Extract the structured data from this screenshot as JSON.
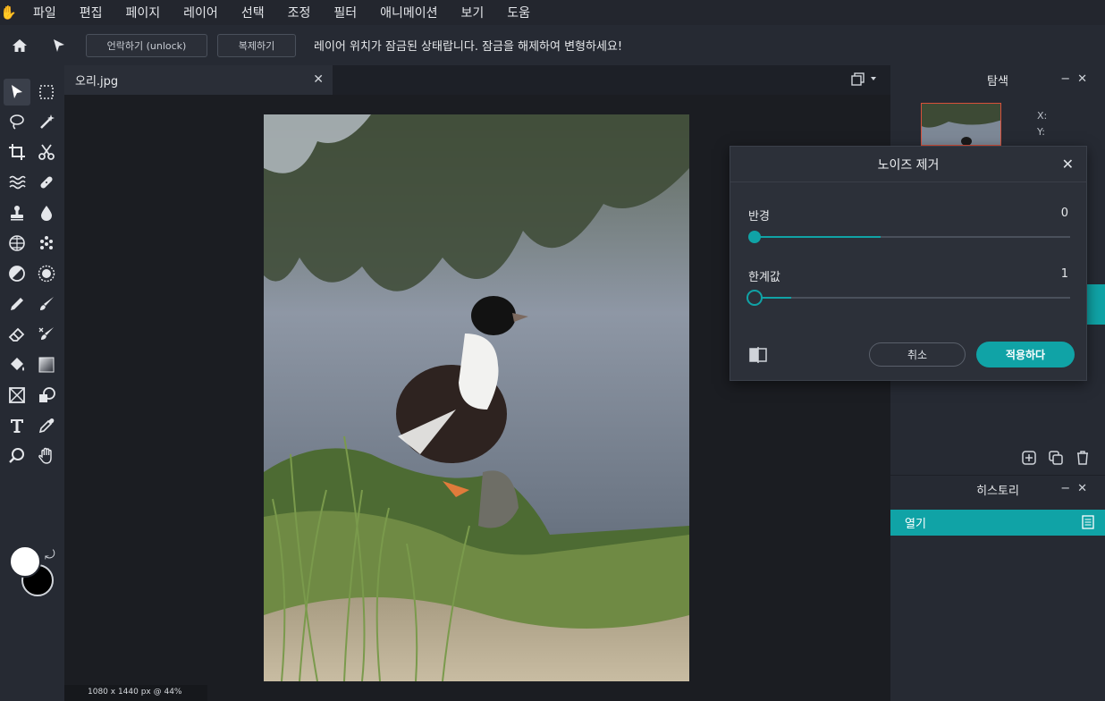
{
  "menu": [
    "파일",
    "편집",
    "페이지",
    "레이어",
    "선택",
    "조정",
    "필터",
    "애니메이션",
    "보기",
    "도움"
  ],
  "options": {
    "unlock_label": "언락하기 (unlock)",
    "duplicate_label": "복제하기",
    "message": "레이어 위치가 잠금된 상태랍니다. 잠금을 해제하여 변형하세요!"
  },
  "document": {
    "tab_name": "오리.jpg",
    "status": "1080 x 1440 px @ 44%"
  },
  "colors": {
    "foreground": "#ffffff",
    "background": "#000000",
    "accent": "#10a3a6"
  },
  "navigator": {
    "title": "탐색",
    "x_label": "X:",
    "y_label": "Y:"
  },
  "history": {
    "title": "히스토리",
    "items": [
      "열기"
    ]
  },
  "noise_dialog": {
    "title": "노이즈 제거",
    "radius_label": "반경",
    "radius_value": "0",
    "threshold_label": "한계값",
    "threshold_value": "1",
    "radius_fill": 0.4,
    "threshold_fill": 0.12,
    "cancel_label": "취소",
    "apply_label": "적용하다"
  }
}
